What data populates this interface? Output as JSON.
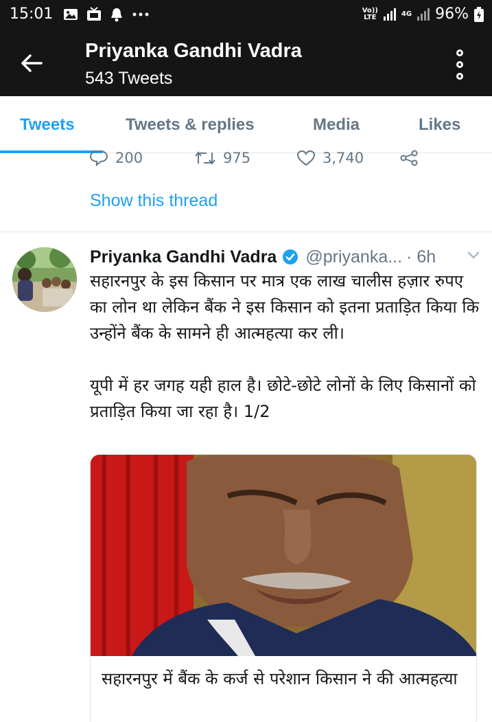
{
  "status_bar": {
    "time": "15:01",
    "volte_label_top": "Vo))",
    "volte_label_bottom": "LTE",
    "network_label": "4G",
    "battery": "96%",
    "icons": [
      "gallery-icon",
      "tv-icon",
      "notification-bell-icon",
      "more-dots-icon",
      "signal-icon",
      "battery-icon"
    ]
  },
  "header": {
    "title": "Priyanka Gandhi Vadra",
    "subtitle": "543 Tweets"
  },
  "tabs": [
    {
      "label": "Tweets",
      "active": true
    },
    {
      "label": "Tweets & replies",
      "active": false
    },
    {
      "label": "Media",
      "active": false
    },
    {
      "label": "Likes",
      "active": false
    }
  ],
  "prev_tweet": {
    "replies": "200",
    "retweets": "975",
    "likes": "3,740",
    "show_thread": "Show this thread"
  },
  "tweet": {
    "name": "Priyanka Gandhi Vadra",
    "handle": "@priyanka...",
    "time": "· 6h",
    "text": "सहारनपुर के इस किसान पर मात्र एक लाख चालीस हज़ार रुपए का लोन था लेकिन बैंक ने इस किसान को इतना प्रताड़ित किया कि उन्होंने बैंक के सामने ही आत्महत्या कर ली।\n\nयूपी में हर जगह यही हाल है। छोटे-छोटे लोनों के लिए किसानों को प्रताड़ित किया जा रहा है। 1/2",
    "card_title": "सहारनपुर में बैंक के कर्ज से परेशान किसान ने की आत्महत्या"
  },
  "colors": {
    "accent": "#1da1f2",
    "header_bg": "#151515",
    "muted": "#657786"
  }
}
